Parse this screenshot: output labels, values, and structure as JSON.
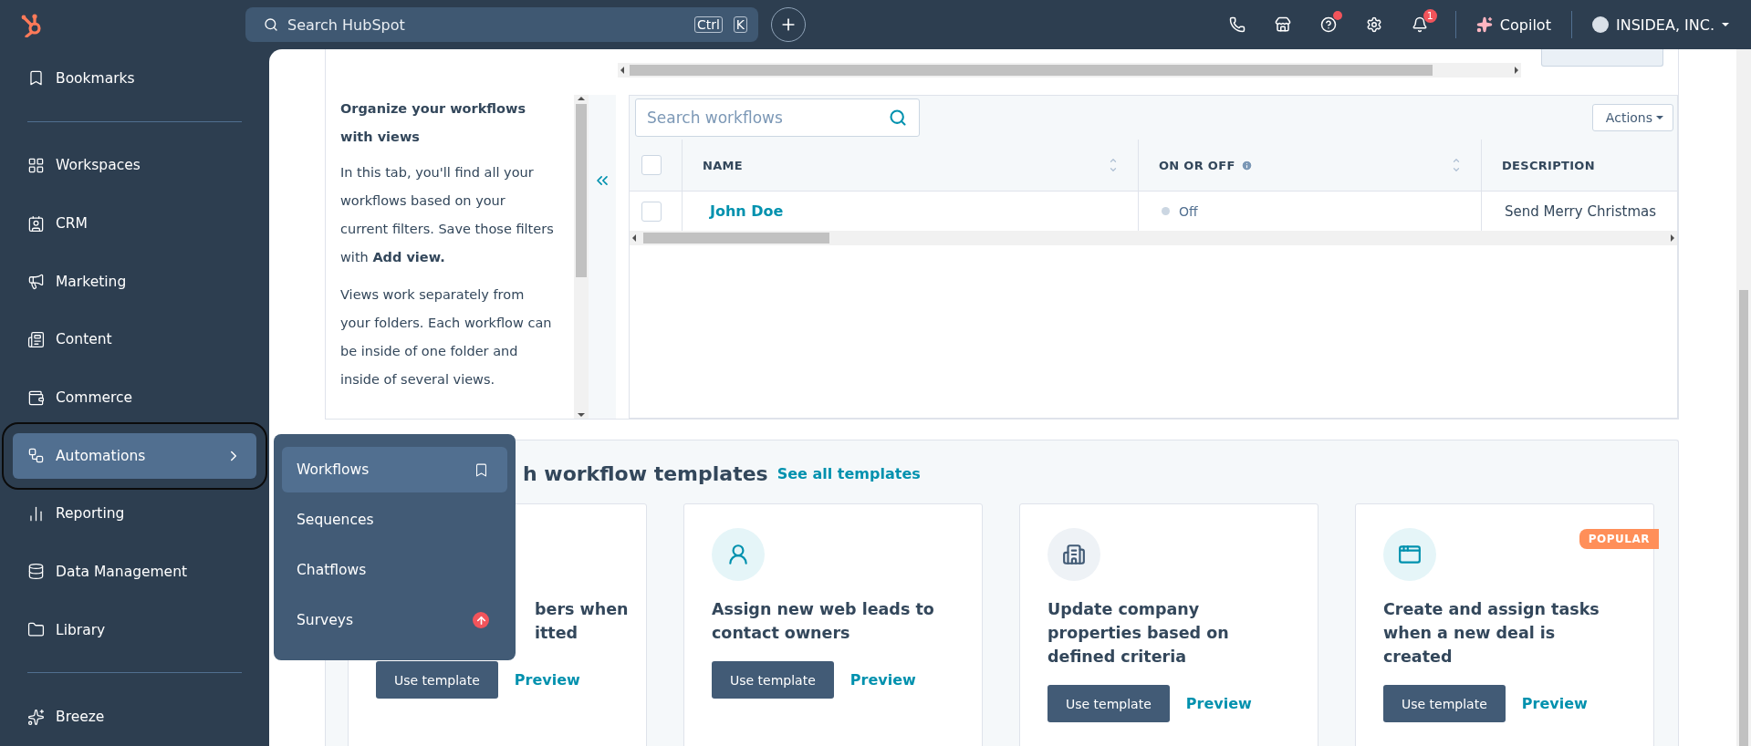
{
  "topbar": {
    "search": {
      "placeholder": "Search HubSpot",
      "keys": [
        "Ctrl",
        "K"
      ]
    },
    "help_alert": true,
    "notifications": "1",
    "copilot": "Copilot",
    "account": "INSIDEA, INC."
  },
  "sidebar": {
    "groups": [
      {
        "items": [
          {
            "label": "Bookmarks",
            "selected": false
          }
        ]
      },
      {
        "items": [
          {
            "label": "Workspaces",
            "selected": false
          },
          {
            "label": "CRM",
            "selected": false
          },
          {
            "label": "Marketing",
            "selected": false
          },
          {
            "label": "Content",
            "selected": false
          },
          {
            "label": "Commerce",
            "selected": false
          },
          {
            "label": "Automations",
            "selected": true
          },
          {
            "label": "Reporting",
            "selected": false
          },
          {
            "label": "Data Management",
            "selected": false
          },
          {
            "label": "Library",
            "selected": false
          }
        ]
      },
      {
        "items": [
          {
            "label": "Breeze",
            "selected": false
          }
        ]
      }
    ]
  },
  "flyout": {
    "items": [
      {
        "label": "Workflows",
        "selected": true,
        "upgrade": false
      },
      {
        "label": "Sequences",
        "selected": false,
        "upgrade": false
      },
      {
        "label": "Chatflows",
        "selected": false,
        "upgrade": false
      },
      {
        "label": "Surveys",
        "selected": false,
        "upgrade": true
      }
    ]
  },
  "views_panel": {
    "title": "Organize your workflows with views",
    "paragraphs": [
      "In this tab, you'll find all your workflows based on your current filters. Save those filters with **Add view.**",
      "Views work separately from your folders. Each workflow can be inside of one folder and inside of several views."
    ]
  },
  "table": {
    "search": {
      "placeholder": "Search workflows"
    },
    "actions": "Actions",
    "select_all": false,
    "columns": [
      {
        "label": "NAME",
        "sortable": true,
        "info": false
      },
      {
        "label": "ON OR OFF",
        "sortable": true,
        "info": true
      },
      {
        "label": "DESCRIPTION",
        "info": false
      }
    ],
    "rows": [
      {
        "selected": false,
        "name": "John Doe",
        "on": false,
        "status": "Off",
        "description": "Send Merry Christmas"
      }
    ]
  },
  "templates": {
    "heading": "h workflow templates",
    "link": "See all templates",
    "cards": [
      {
        "title_lines": [
          "bers when",
          "itted"
        ],
        "button": "Use template",
        "link": "Preview"
      },
      {
        "title_lines": [
          "Assign new web leads to",
          "contact owners"
        ],
        "button": "Use template",
        "link": "Preview"
      },
      {
        "title_lines": [
          "Update company",
          "properties based on",
          "defined criteria"
        ],
        "button": "Use template",
        "link": "Preview"
      },
      {
        "badge": "POPULAR",
        "title_lines": [
          "Create and assign tasks",
          "when a new deal is",
          "created"
        ],
        "button": "Use template",
        "link": "Preview"
      }
    ]
  }
}
